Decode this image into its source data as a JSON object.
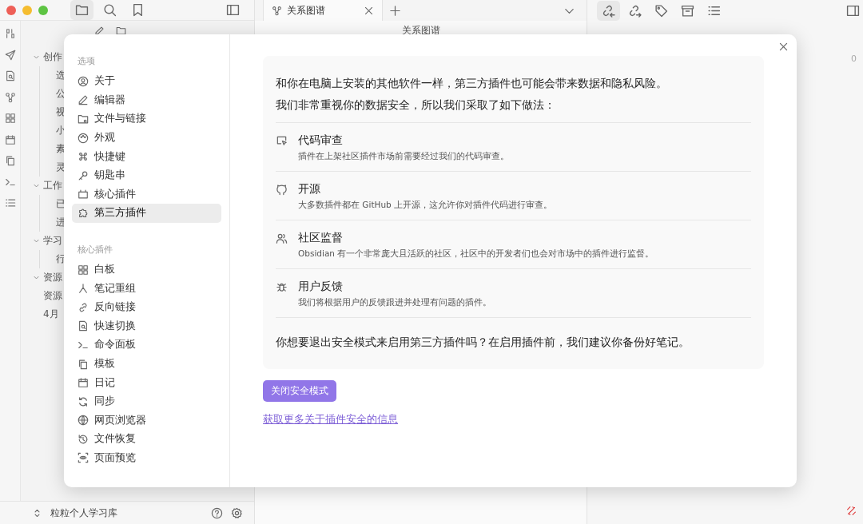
{
  "app": {
    "tab": {
      "title": "关系图谱"
    },
    "view_header": {
      "title": "关系图谱"
    },
    "file_tree": [
      {
        "label": "创作",
        "expanded": true,
        "children": [
          {
            "label": "选"
          },
          {
            "label": "公"
          },
          {
            "label": "视"
          },
          {
            "label": "小"
          },
          {
            "label": "素"
          },
          {
            "label": "灵"
          }
        ]
      },
      {
        "label": "工作",
        "expanded": true,
        "children": [
          {
            "label": "已"
          },
          {
            "label": "进"
          }
        ]
      },
      {
        "label": "学习",
        "expanded": true,
        "children": [
          {
            "label": "行"
          }
        ]
      },
      {
        "label": "资源",
        "expanded": true
      },
      {
        "label": "资源"
      },
      {
        "label": "4月"
      }
    ],
    "vault": "粒粒个人学习库",
    "right_panel_count": "0"
  },
  "settings": {
    "sections": [
      {
        "heading": "选项",
        "items": [
          {
            "label": "关于",
            "selected": false
          },
          {
            "label": "编辑器",
            "selected": false
          },
          {
            "label": "文件与链接",
            "selected": false
          },
          {
            "label": "外观",
            "selected": false
          },
          {
            "label": "快捷键",
            "selected": false
          },
          {
            "label": "钥匙串",
            "selected": false
          },
          {
            "label": "核心插件",
            "selected": false
          },
          {
            "label": "第三方插件",
            "selected": true
          }
        ]
      },
      {
        "heading": "核心插件",
        "items": [
          {
            "label": "白板",
            "selected": false
          },
          {
            "label": "笔记重组",
            "selected": false
          },
          {
            "label": "反向链接",
            "selected": false
          },
          {
            "label": "快速切换",
            "selected": false
          },
          {
            "label": "命令面板",
            "selected": false
          },
          {
            "label": "模板",
            "selected": false
          },
          {
            "label": "日记",
            "selected": false
          },
          {
            "label": "同步",
            "selected": false
          },
          {
            "label": "网页浏览器",
            "selected": false
          },
          {
            "label": "文件恢复",
            "selected": false
          },
          {
            "label": "页面预览",
            "selected": false
          }
        ]
      }
    ]
  },
  "content": {
    "intro": "和你在电脑上安装的其他软件一样，第三方插件也可能会带来数据和隐私风险。",
    "lead": "我们非常重视你的数据安全，所以我们采取了如下做法：",
    "measures": [
      {
        "title": "代码审查",
        "description": "插件在上架社区插件市场前需要经过我们的代码审查。"
      },
      {
        "title": "开源",
        "description": "大多数插件都在 GitHub 上开源，这允许你对插件代码进行审查。"
      },
      {
        "title": "社区监督",
        "description": "Obsidian 有一个非常庞大且活跃的社区，社区中的开发者们也会对市场中的插件进行监督。"
      },
      {
        "title": "用户反馈",
        "description": "我们将根据用户的反馈跟进并处理有问题的插件。"
      }
    ],
    "question": "你想要退出安全模式来启用第三方插件吗？在启用插件前，我们建议你备份好笔记。",
    "button": "关闭安全模式",
    "link": "获取更多关于插件安全的信息"
  }
}
